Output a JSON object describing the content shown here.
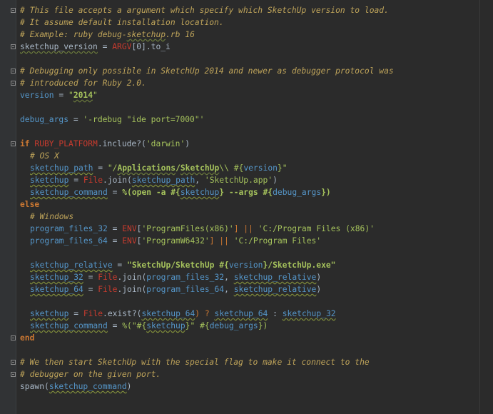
{
  "editor": {
    "lines": {
      "l1": "# This file accepts a argument which specify which SketchUp version to load.",
      "l2": "# It assume default installation location.",
      "l3a": "# Example: ruby debug-",
      "l3b": "sketchup",
      "l3c": ".rb 16",
      "l4a": "sketchup_version",
      "l4b": " = ",
      "l4c": "ARGV",
      "l4d": "[0].to_i",
      "l6": "# Debugging only possible in SketchUp 2014 and newer as debugger protocol was",
      "l7": "# introduced for Ruby 2.0.",
      "l8a": "version",
      "l8b": " = ",
      "l8c": "\"",
      "l8d": "2014",
      "l8e": "\"",
      "l10a": "debug_args",
      "l10b": " = ",
      "l10c": "'-rdebug \"ide port=7000\"'",
      "l12a": "if ",
      "l12b": "RUBY_PLATFORM",
      "l12c": ".include?(",
      "l12d": "'darwin'",
      "l12e": ")",
      "l13": "# OS X",
      "l14a": "sketchup_path",
      "l14b": " = ",
      "l14c": "\"/",
      "l14d": "Applications",
      "l14e": "/",
      "l14f": "SketchUp",
      "l14g": "\\\\ #{",
      "l14h": "version",
      "l14i": "}\"",
      "l15a": "sketchup",
      "l15b": " = ",
      "l15c": "File",
      "l15d": ".join(",
      "l15e": "sketchup_path",
      "l15f": ", ",
      "l15g": "'SketchUp.app'",
      "l15h": ")",
      "l16a": "sketchup_command",
      "l16b": " = ",
      "l16c": "%(open -a #{",
      "l16d": "sketchup",
      "l16e": "} --args #{",
      "l16f": "debug_args",
      "l16g": "})",
      "l17": "else",
      "l18": "# Windows",
      "l19a": "program_files_32",
      "l19b": " = ",
      "l19c": "ENV",
      "l19d": "[",
      "l19e": "'ProgramFiles(x86)'",
      "l19f": "] || ",
      "l19g": "'C:/Program Files (x86)'",
      "l20a": "program_files_64",
      "l20b": " = ",
      "l20c": "ENV",
      "l20d": "[",
      "l20e": "'ProgramW6432'",
      "l20f": "] || ",
      "l20g": "'C:/Program Files'",
      "l22a": "sketchup_relative",
      "l22b": " = ",
      "l22c": "\"SketchUp/SketchUp #{",
      "l22d": "version",
      "l22e": "}/SketchUp.exe\"",
      "l23a": "sketchup_32",
      "l23b": " = ",
      "l23c": "File",
      "l23d": ".join(",
      "l23e": "program_files_32",
      "l23f": ", ",
      "l23g": "sketchup_relative",
      "l23h": ")",
      "l24a": "sketchup_64",
      "l24b": " = ",
      "l24c": "File",
      "l24d": ".join(",
      "l24e": "program_files_64",
      "l24f": ", ",
      "l24g": "sketchup_relative",
      "l24h": ")",
      "l26a": "sketchup",
      "l26b": " = ",
      "l26c": "File",
      "l26d": ".exist?(",
      "l26e": "sketchup_64",
      "l26f": ") ? ",
      "l26g": "sketchup_64",
      "l26h": " : ",
      "l26i": "sketchup_32",
      "l27a": "sketchup_command",
      "l27b": " = ",
      "l27c": "%(\"#{",
      "l27d": "sketchup",
      "l27e": "}\" #{",
      "l27f": "debug_args",
      "l27g": "})",
      "l28": "end",
      "l30": "# We then start SketchUp with the special flag to make it connect to the",
      "l31": "# debugger on the given port.",
      "l32a": "spawn(",
      "l32b": "sketchup_command",
      "l32c": ")"
    }
  },
  "colors": {
    "background": "#2b2b2b",
    "gutter": "#313335",
    "comment": "#bfa45a",
    "keyword": "#cc7832",
    "constant": "#c83b2e",
    "string": "#a5c25c",
    "variable": "#5596c9",
    "text": "#a9b7c6"
  },
  "icons": {
    "fold_markers": "fold-marker-icon"
  }
}
